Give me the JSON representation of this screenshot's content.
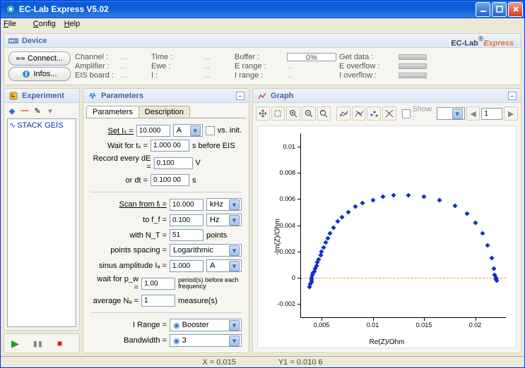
{
  "window": {
    "title": "EC-Lab Express V5.02"
  },
  "menu": {
    "file": "File",
    "config": "Config",
    "help": "Help"
  },
  "brand": {
    "name": "EC-Lab",
    "suffix": "Express"
  },
  "device": {
    "header": "Device",
    "connect_btn": "Connect...",
    "infos_btn": "Infos...",
    "labels": {
      "channel": "Channel :",
      "time": "Time :",
      "buffer": "Buffer :",
      "get_data": "Get data :",
      "amplifier": "Amplifier :",
      "ewe": "Ewe :",
      "erange": "E range :",
      "eoverflow": "E overflow :",
      "eis": "EIS board :",
      "i": "I :",
      "irange": "I range :",
      "ioverflow": "I overflow :"
    },
    "vals": {
      "channel": "...",
      "time": "...",
      "buffer_pct": "0%",
      "amplifier": "...",
      "ewe": "...",
      "erange": "...",
      "eis": "...",
      "i": "...",
      "irange": "..."
    }
  },
  "experiment": {
    "header": "Experiment",
    "item1": "STACK GEIS"
  },
  "parameters": {
    "header": "Parameters",
    "tabs": {
      "params": "Parameters",
      "desc": "Description"
    },
    "set_is_lbl": "Set Iₛ =",
    "set_is_val": "10.000",
    "set_is_unit": "A",
    "vs_init": "vs. init.",
    "wait_ts_lbl": "Wait for tₛ =",
    "wait_ts_val": "1.000 00",
    "wait_ts_suffix": "s  before EIS",
    "rec_de_lbl": "Record every dE =",
    "rec_de_val": "0.100",
    "rec_de_unit": "V",
    "rec_dt_lbl": "or  dt =",
    "rec_dt_val": "0.100 00",
    "rec_dt_unit": "s",
    "scan_fi_lbl": "Scan from fᵢ =",
    "scan_fi_val": "10.000",
    "scan_fi_unit": "kHz",
    "scan_ff_lbl": "to  f_f =",
    "scan_ff_val": "0.100",
    "scan_ff_unit": "Hz",
    "nt_lbl": "with  N_T =",
    "nt_val": "51",
    "nt_suffix": "points",
    "spacing_lbl": "points spacing =",
    "spacing_val": "Logarithmic",
    "ia_lbl": "sinus amplitude Iₐ =",
    "ia_val": "1.000",
    "ia_unit": "A",
    "pw_lbl": "wait for p_w =",
    "pw_val": "1.00",
    "pw_suffix": "period(s) before each frequency",
    "na_lbl": "average Nₐ =",
    "na_val": "1",
    "na_suffix": "measure(s)",
    "irange_lbl": "I Range =",
    "irange_val": "Booster",
    "bw_lbl": "Bandwidth =",
    "bw_val": "3"
  },
  "graph": {
    "header": "Graph",
    "show_lbl": "Show :",
    "page_num": "1"
  },
  "chart_data": {
    "type": "scatter",
    "xlabel": "Re(Z)/Ohm",
    "ylabel": "-Im(Z)/Ohm",
    "xlim": [
      0.003,
      0.023
    ],
    "ylim": [
      -0.003,
      0.011
    ],
    "xticks": [
      0.005,
      0.01,
      0.015,
      0.02
    ],
    "yticks": [
      -0.002,
      0,
      0.002,
      0.004,
      0.006,
      0.008,
      0.01
    ],
    "points": [
      [
        0.0038,
        -0.0007
      ],
      [
        0.0039,
        -0.0005
      ],
      [
        0.004,
        -0.0003
      ],
      [
        0.004,
        -0.00015
      ],
      [
        0.004,
        0.0
      ],
      [
        0.0041,
        0.0002
      ],
      [
        0.0042,
        0.0004
      ],
      [
        0.0043,
        0.0005
      ],
      [
        0.0044,
        0.0007
      ],
      [
        0.0045,
        0.0009
      ],
      [
        0.0046,
        0.0012
      ],
      [
        0.0047,
        0.0014
      ],
      [
        0.0049,
        0.0017
      ],
      [
        0.005,
        0.002
      ],
      [
        0.0052,
        0.0023
      ],
      [
        0.0054,
        0.0027
      ],
      [
        0.0056,
        0.003
      ],
      [
        0.0058,
        0.0034
      ],
      [
        0.0062,
        0.0038
      ],
      [
        0.0066,
        0.0043
      ],
      [
        0.007,
        0.0046
      ],
      [
        0.0076,
        0.005
      ],
      [
        0.0083,
        0.0054
      ],
      [
        0.009,
        0.0057
      ],
      [
        0.01,
        0.0059
      ],
      [
        0.011,
        0.0062
      ],
      [
        0.012,
        0.0063
      ],
      [
        0.0135,
        0.0063
      ],
      [
        0.015,
        0.0062
      ],
      [
        0.0165,
        0.0059
      ],
      [
        0.018,
        0.0055
      ],
      [
        0.0192,
        0.0049
      ],
      [
        0.02,
        0.0042
      ],
      [
        0.0207,
        0.0034
      ],
      [
        0.0212,
        0.0025
      ],
      [
        0.0216,
        0.0015
      ],
      [
        0.0218,
        0.0007
      ],
      [
        0.0219,
        0.0002
      ],
      [
        0.022,
        0.0
      ],
      [
        0.022,
        -0.0001
      ],
      [
        0.0221,
        -0.0002
      ]
    ]
  },
  "status": {
    "x": "X = 0.015",
    "y": "Y1 = 0.010 6"
  }
}
